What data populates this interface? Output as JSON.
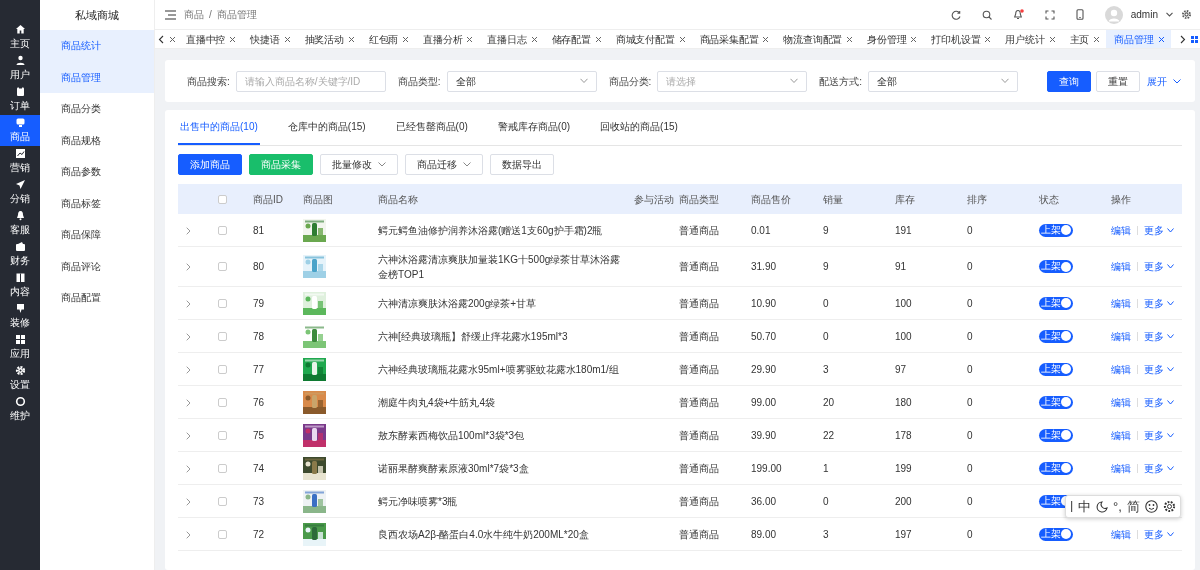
{
  "brand": "私域商城",
  "main_nav": [
    {
      "label": "主页",
      "selected": false
    },
    {
      "label": "用户",
      "selected": false
    },
    {
      "label": "订单",
      "selected": false
    },
    {
      "label": "商品",
      "selected": true
    },
    {
      "label": "营销",
      "selected": false
    },
    {
      "label": "分销",
      "selected": false
    },
    {
      "label": "客服",
      "selected": false
    },
    {
      "label": "财务",
      "selected": false
    },
    {
      "label": "内容",
      "selected": false
    },
    {
      "label": "装修",
      "selected": false
    },
    {
      "label": "应用",
      "selected": false
    },
    {
      "label": "设置",
      "selected": false
    },
    {
      "label": "维护",
      "selected": false
    }
  ],
  "sub_nav": [
    {
      "label": "商品统计",
      "selected": true
    },
    {
      "label": "商品管理",
      "selected": true
    },
    {
      "label": "商品分类",
      "selected": false
    },
    {
      "label": "商品规格",
      "selected": false
    },
    {
      "label": "商品参数",
      "selected": false
    },
    {
      "label": "商品标签",
      "selected": false
    },
    {
      "label": "商品保障",
      "selected": false
    },
    {
      "label": "商品评论",
      "selected": false
    },
    {
      "label": "商品配置",
      "selected": false
    }
  ],
  "breadcrumb": [
    "商品",
    "商品管理"
  ],
  "breadcrumb_separator": "/",
  "user": {
    "name": "admin",
    "notification": true
  },
  "open_tabs": [
    {
      "label": "直播中控",
      "selected": false
    },
    {
      "label": "快捷语",
      "selected": false
    },
    {
      "label": "抽奖活动",
      "selected": false
    },
    {
      "label": "红包雨",
      "selected": false
    },
    {
      "label": "直播分析",
      "selected": false
    },
    {
      "label": "直播日志",
      "selected": false
    },
    {
      "label": "储存配置",
      "selected": false
    },
    {
      "label": "商城支付配置",
      "selected": false
    },
    {
      "label": "商品采集配置",
      "selected": false
    },
    {
      "label": "物流查询配置",
      "selected": false
    },
    {
      "label": "身份管理",
      "selected": false
    },
    {
      "label": "打印机设置",
      "selected": false
    },
    {
      "label": "用户统计",
      "selected": false
    },
    {
      "label": "主页",
      "selected": false
    },
    {
      "label": "商品管理",
      "selected": true
    }
  ],
  "filters": [
    {
      "label": "商品搜索:",
      "kind": "input",
      "placeholder": "请输入商品名称/关键字/ID"
    },
    {
      "label": "商品类型:",
      "kind": "select",
      "value": "全部"
    },
    {
      "label": "商品分类:",
      "kind": "select",
      "placeholder": "请选择"
    },
    {
      "label": "配送方式:",
      "kind": "select",
      "value": "全部"
    }
  ],
  "filter_buttons": [
    {
      "label": "查询",
      "kind": "primary"
    },
    {
      "label": "重置",
      "kind": "plain"
    },
    {
      "label": "展开",
      "kind": "link"
    }
  ],
  "status_tabs": [
    {
      "label": "出售中的商品(10)",
      "selected": true
    },
    {
      "label": "仓库中的商品(15)",
      "selected": false
    },
    {
      "label": "已经售罄商品(0)",
      "selected": false
    },
    {
      "label": "警戒库存商品(0)",
      "selected": false
    },
    {
      "label": "回收站的商品(15)",
      "selected": false
    }
  ],
  "toolbar": [
    {
      "label": "添加商品",
      "kind": "primary"
    },
    {
      "label": "商品采集",
      "kind": "success"
    },
    {
      "label": "批量修改",
      "kind": "dropdown"
    },
    {
      "label": "商品迁移",
      "kind": "dropdown"
    },
    {
      "label": "数据导出",
      "kind": "plain"
    }
  ],
  "table": {
    "all_checked": false,
    "columns": [
      "商品ID",
      "商品图",
      "商品名称",
      "参与活动",
      "商品类型",
      "商品售价",
      "销量",
      "库存",
      "排序",
      "状态",
      "操作"
    ],
    "rows": [
      {
        "id": "81",
        "image": {
          "kind": "picture"
        },
        "name": "鳄元鳄鱼油修护润养沐浴露(赠送1支60g护手霜)2瓶",
        "type": "普通商品",
        "price": "0.01",
        "sales": "9",
        "stock": "191",
        "sort": "0",
        "status": "上架",
        "on": true,
        "checked": false,
        "actions": [
          "编辑",
          "更多"
        ]
      },
      {
        "id": "80",
        "image": {
          "kind": "picture"
        },
        "name": "六神沐浴露清凉爽肤加量装1KG十500g绿茶甘草沐浴露金榜TOP1",
        "type": "普通商品",
        "price": "31.90",
        "sales": "9",
        "stock": "91",
        "sort": "0",
        "status": "上架",
        "on": true,
        "checked": false,
        "actions": [
          "编辑",
          "更多"
        ]
      },
      {
        "id": "79",
        "image": {
          "kind": "picture"
        },
        "name": "六神清凉爽肤沐浴露200g绿茶+甘草",
        "type": "普通商品",
        "price": "10.90",
        "sales": "0",
        "stock": "100",
        "sort": "0",
        "status": "上架",
        "on": true,
        "checked": false,
        "actions": [
          "编辑",
          "更多"
        ]
      },
      {
        "id": "78",
        "image": {
          "kind": "picture"
        },
        "name": "六神[经典玻璃瓶】舒缓止痒花露水195ml*3",
        "type": "普通商品",
        "price": "50.70",
        "sales": "0",
        "stock": "100",
        "sort": "0",
        "status": "上架",
        "on": true,
        "checked": false,
        "actions": [
          "编辑",
          "更多"
        ]
      },
      {
        "id": "77",
        "image": {
          "kind": "picture"
        },
        "name": "六神经典玻璃瓶花露水95ml+喷雾驱蚊花露水180m1/组",
        "type": "普通商品",
        "price": "29.90",
        "sales": "3",
        "stock": "97",
        "sort": "0",
        "status": "上架",
        "on": true,
        "checked": false,
        "actions": [
          "编辑",
          "更多"
        ]
      },
      {
        "id": "76",
        "image": {
          "kind": "picture"
        },
        "name": "潮庭牛肉丸4袋+牛筋丸4袋",
        "type": "普通商品",
        "price": "99.00",
        "sales": "20",
        "stock": "180",
        "sort": "0",
        "status": "上架",
        "on": true,
        "checked": false,
        "actions": [
          "编辑",
          "更多"
        ]
      },
      {
        "id": "75",
        "image": {
          "kind": "picture"
        },
        "name": "敖东酵素西梅饮品100ml*3袋*3包",
        "type": "普通商品",
        "price": "39.90",
        "sales": "22",
        "stock": "178",
        "sort": "0",
        "status": "上架",
        "on": true,
        "checked": false,
        "actions": [
          "编辑",
          "更多"
        ]
      },
      {
        "id": "74",
        "image": {
          "kind": "picture"
        },
        "name": "诺丽果酵爽酵素原液30ml*7袋*3盒",
        "type": "普通商品",
        "price": "199.00",
        "sales": "1",
        "stock": "199",
        "sort": "0",
        "status": "上架",
        "on": true,
        "checked": false,
        "actions": [
          "编辑",
          "更多"
        ]
      },
      {
        "id": "73",
        "image": {
          "kind": "picture"
        },
        "name": "鳄元净味喷雾*3瓶",
        "type": "普通商品",
        "price": "36.00",
        "sales": "0",
        "stock": "200",
        "sort": "0",
        "status": "上架",
        "on": true,
        "checked": false
      },
      {
        "id": "72",
        "image": {
          "kind": "picture"
        },
        "name": "良西农场A2β-酪蛋白4.0水牛纯牛奶200ML*20盒",
        "type": "普通商品",
        "price": "89.00",
        "sales": "3",
        "stock": "197",
        "sort": "0",
        "status": "上架",
        "on": true,
        "checked": false,
        "actions": [
          "编辑",
          "更多"
        ]
      }
    ]
  },
  "ime_toolbar": {
    "mode": "中",
    "punctuation": "°,",
    "script": "简"
  }
}
